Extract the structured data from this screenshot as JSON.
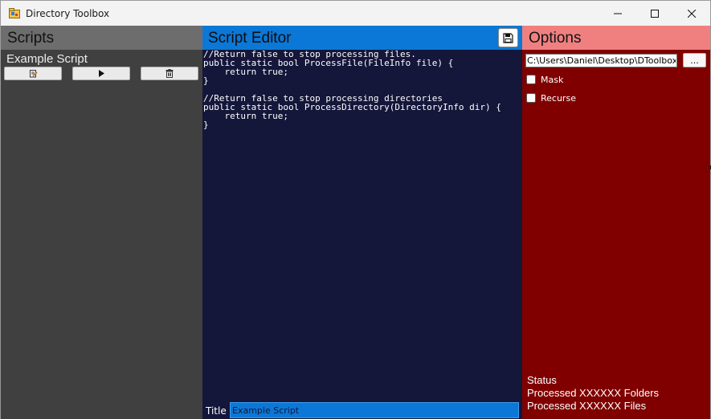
{
  "window": {
    "title": "Directory Toolbox",
    "controls": [
      "minimize",
      "maximize",
      "close"
    ]
  },
  "scripts_panel": {
    "title": "Scripts",
    "items": [
      {
        "label": "Example Script"
      }
    ],
    "buttons": [
      {
        "icon": "edit-icon"
      },
      {
        "icon": "play-icon"
      },
      {
        "icon": "delete-icon"
      }
    ],
    "colors": {
      "header": "#6d6d6d",
      "body": "#404040"
    }
  },
  "editor_panel": {
    "title": "Script Editor",
    "save_icon": "save-icon",
    "code": "//Return false to stop processing files.\npublic static bool ProcessFile(FileInfo file) {\n    return true;\n}\n\n//Return false to stop processing directories\npublic static bool ProcessDirectory(DirectoryInfo dir) {\n    return true;\n}",
    "title_label": "Title",
    "title_value": "Example Script",
    "colors": {
      "header": "#0b78d7",
      "body": "#14163a"
    }
  },
  "options_panel": {
    "title": "Options",
    "path_value": "C:\\Users\\Daniel\\Desktop\\DToolbox\\D",
    "browse_label": "...",
    "checkboxes": [
      {
        "label": "Mask",
        "checked": false
      },
      {
        "label": "Recurse",
        "checked": false
      }
    ],
    "status": {
      "heading": "Status",
      "folders": "Processed XXXXXX Folders",
      "files": "Processed XXXXXX Files"
    },
    "colors": {
      "header": "#f08080",
      "body": "#800000"
    }
  }
}
